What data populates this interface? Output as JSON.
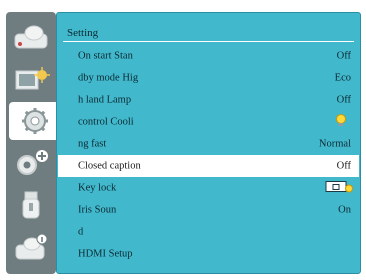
{
  "panel": {
    "title": "Setting"
  },
  "rows": [
    {
      "label": "On start  Stan",
      "value": "Off"
    },
    {
      "label": "dby mode  Hig",
      "value": "Eco"
    },
    {
      "label": "h land  Lamp",
      "value": "Off"
    },
    {
      "label": "control  Cooli",
      "value": "",
      "icon": "lightbulb-icon"
    },
    {
      "label": "ng fast",
      "value": "Normal"
    },
    {
      "label": "Closed caption",
      "value": "Off",
      "selected": true
    },
    {
      "label": "Key lock",
      "value": "",
      "icon": "key-lock-remote-icon"
    },
    {
      "label": "Iris  Soun",
      "value": "On"
    },
    {
      "label": "d",
      "value": ""
    },
    {
      "label": "HDMI Setup",
      "value": ""
    }
  ],
  "sidebar": {
    "tabs": [
      {
        "name": "picture-adjust-icon"
      },
      {
        "name": "projector-image-icon"
      },
      {
        "name": "settings-gear-icon",
        "active": true
      },
      {
        "name": "expanded-settings-gears-icon"
      },
      {
        "name": "memory-usb-icon"
      },
      {
        "name": "info-icon"
      }
    ]
  }
}
